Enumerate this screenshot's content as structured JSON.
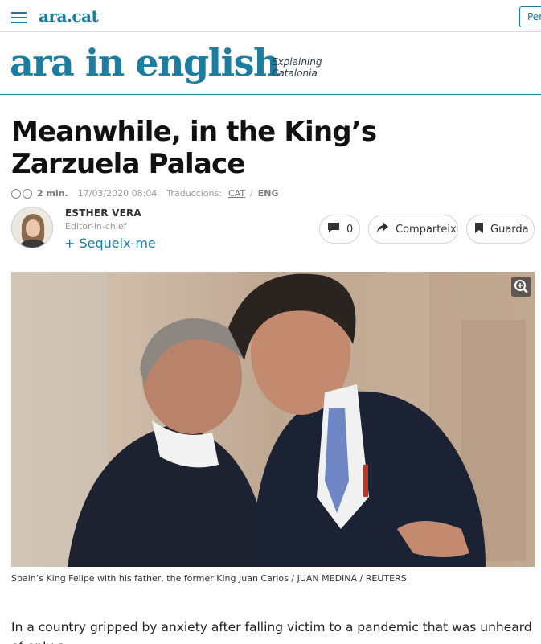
{
  "header": {
    "site_logo": "ara.cat",
    "right_button": "Per"
  },
  "section": {
    "logo": "ara in english",
    "tagline": "Explaining Catalonia"
  },
  "article": {
    "headline": "Meanwhile, in the King’s Zarzuela Palace",
    "read_time": "2 min.",
    "date": "17/03/2020 08:04",
    "translations_label": "Traduccions:",
    "lang_cat": "CAT",
    "lang_sep": "/",
    "lang_eng": "ENG",
    "author": {
      "name": "ESTHER VERA",
      "role": "Editor-in-chief",
      "follow": "+ Sequeix-me"
    },
    "actions": {
      "comments_count": "0",
      "share_label": "Comparteix",
      "save_label": "Guarda"
    },
    "image_caption": "Spain’s King Felipe with his father, the former King Juan Carlos / JUAN MEDINA / REUTERS",
    "body_first_line": "In a country gripped by anxiety after falling victim to a pandemic that was unheard of only a"
  },
  "icons": [
    "menu-icon",
    "glasses-icon",
    "comment-icon",
    "share-icon",
    "bookmark-icon",
    "zoom-in-icon"
  ],
  "colors": {
    "brand": "#1b7ea1"
  }
}
